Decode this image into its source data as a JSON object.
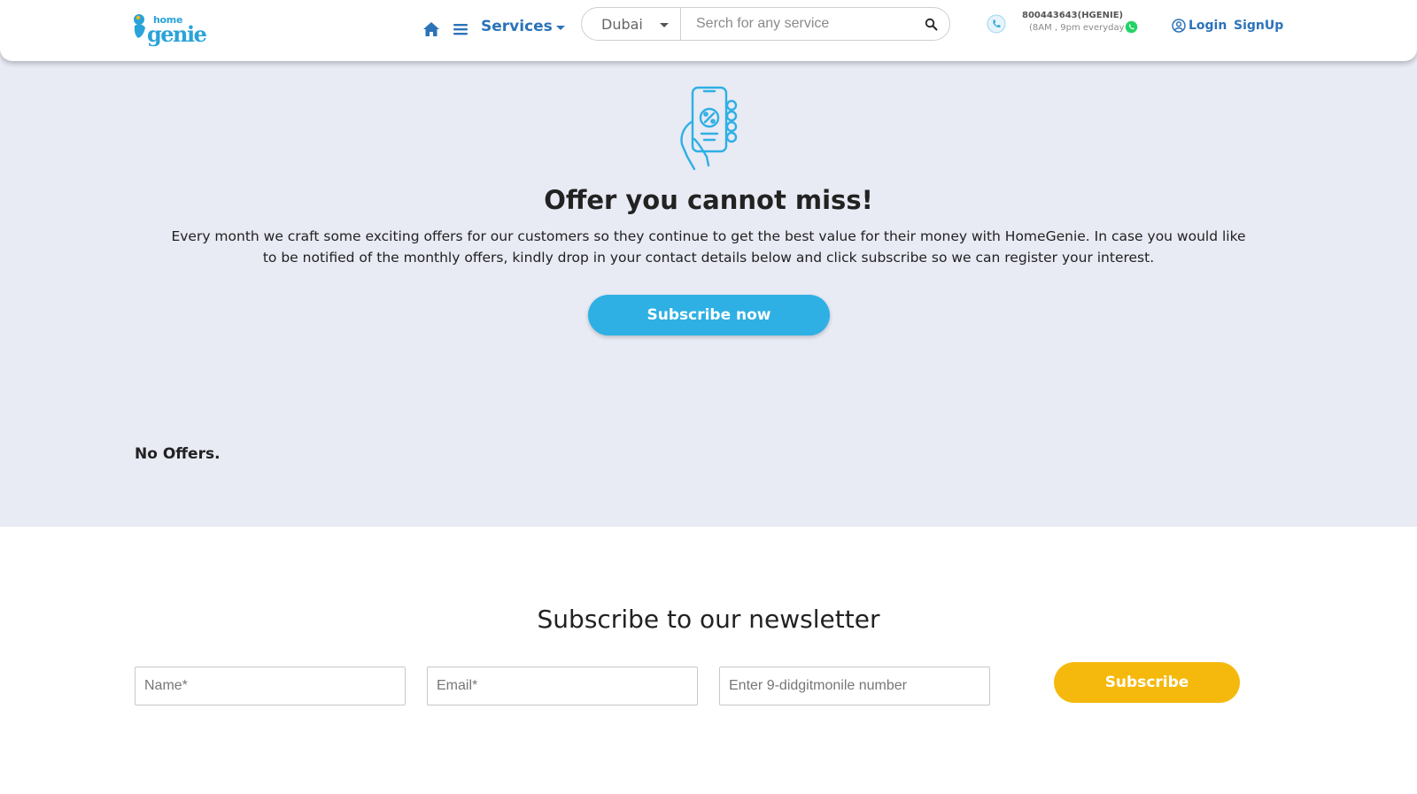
{
  "header": {
    "logo": {
      "line1": "home",
      "line2": "genie"
    },
    "nav": {
      "services_label": "Services"
    },
    "search": {
      "city": "Dubai",
      "placeholder": "Serch for any service"
    },
    "contact": {
      "phone": "800443643(HGENIE)",
      "hours": "(8AM , 9pm everyday"
    },
    "auth": {
      "login_label": "Login",
      "signup_label": "SignUp"
    }
  },
  "offers": {
    "title": "Offer you cannot miss!",
    "description": "Every month we craft some exciting offers for our customers so they continue to get the best value for their money with HomeGenie. In case you would like to be notified of the monthly offers, kindly drop in your contact details below and click subscribe so we can register your interest.",
    "subscribe_label": "Subscribe now",
    "empty_text": "No Offers."
  },
  "newsletter": {
    "title": "Subscribe to our newsletter",
    "name_placeholder": "Name*",
    "email_placeholder": "Email*",
    "mobile_placeholder": "Enter 9-didgitmonile number",
    "subscribe_label": "Subscribe"
  },
  "colors": {
    "brand_blue": "#2aa3d9",
    "nav_blue": "#2c73b8",
    "cta_blue": "#2eb0e4",
    "cta_yellow": "#f5b90d",
    "offer_bg": "#e8eaf4",
    "whatsapp_green": "#25d366"
  },
  "icons": [
    "lamp-icon",
    "home-icon",
    "menu-icon",
    "search-icon",
    "phone-icon",
    "whatsapp-icon",
    "user-icon",
    "mobile-offer-icon"
  ]
}
